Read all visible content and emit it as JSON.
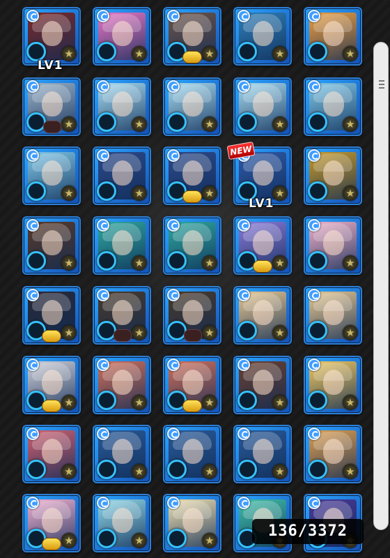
{
  "box": {
    "level_labels": [
      "LV1",
      "LV1"
    ],
    "new_label": "NEW",
    "counter": "136/3372",
    "rows": [
      [
        {
          "c": "#7a2a2a",
          "b": "none"
        },
        {
          "c": "#e877c4",
          "b": "none"
        },
        {
          "c": "#6e5448",
          "b": "gold"
        },
        {
          "c": "#2f7fb8",
          "b": "none"
        },
        {
          "c": "#f0a040",
          "b": "none"
        }
      ],
      [
        {
          "c": "#9bb3c9",
          "b": "dark"
        },
        {
          "c": "#a6dcf2",
          "b": "none"
        },
        {
          "c": "#a6dcf2",
          "b": "none"
        },
        {
          "c": "#a6dcf2",
          "b": "none"
        },
        {
          "c": "#7fc8e8",
          "b": "none"
        }
      ],
      [
        {
          "c": "#7fc8e8",
          "b": "none"
        },
        {
          "c": "#2d4a8a",
          "b": "none"
        },
        {
          "c": "#2d4a8a",
          "b": "gold"
        },
        {
          "c": "#2f5aa8",
          "b": "none"
        },
        {
          "c": "#c89a2a",
          "b": "none"
        }
      ],
      [
        {
          "c": "#5a3a28",
          "b": "none"
        },
        {
          "c": "#2fa8a0",
          "b": "none"
        },
        {
          "c": "#2fa8a0",
          "b": "none"
        },
        {
          "c": "#8a7ad8",
          "b": "gold"
        },
        {
          "c": "#f0b0c8",
          "b": "none"
        }
      ],
      [
        {
          "c": "#2a2a38",
          "b": "gold"
        },
        {
          "c": "#4a3a2a",
          "b": "dark"
        },
        {
          "c": "#4a3a2a",
          "b": "dark"
        },
        {
          "c": "#e8c890",
          "b": "none"
        },
        {
          "c": "#e8c890",
          "b": "none"
        }
      ],
      [
        {
          "c": "#d0d0d8",
          "b": "gold"
        },
        {
          "c": "#d0705a",
          "b": "none"
        },
        {
          "c": "#d0705a",
          "b": "gold"
        },
        {
          "c": "#6a4030",
          "b": "none"
        },
        {
          "c": "#f0c860",
          "b": "none"
        }
      ],
      [
        {
          "c": "#d06070",
          "b": "none"
        },
        {
          "c": "#2a5a98",
          "b": "none"
        },
        {
          "c": "#2a5a98",
          "b": "none"
        },
        {
          "c": "#2a5a98",
          "b": "none"
        },
        {
          "c": "#e0a050",
          "b": "none"
        }
      ],
      [
        {
          "c": "#f0b0d0",
          "b": "gold"
        },
        {
          "c": "#90d8e8",
          "b": "none"
        },
        {
          "c": "#f0e0b0",
          "b": "none"
        },
        {
          "c": "#40c0a8",
          "b": "none"
        },
        {
          "c": "#4a3a98",
          "b": "none"
        }
      ]
    ]
  },
  "icons": {
    "element": "water-element-icon",
    "ring": "luck-ring-icon",
    "star": "star-icon"
  },
  "colors": {
    "card_border": "#2d7fd6",
    "ring": "#36c2ff",
    "badge_gold": "#ffd230"
  }
}
